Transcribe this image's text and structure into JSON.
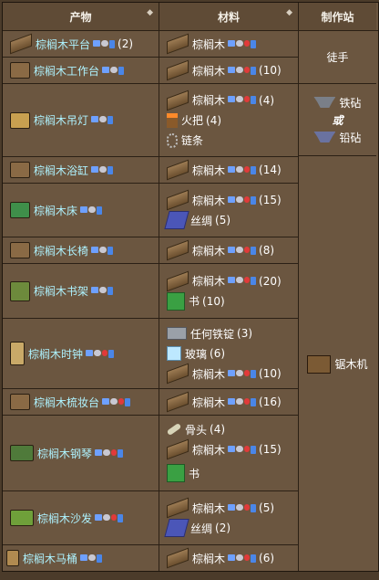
{
  "header": {
    "product": "产物",
    "materials": "材料",
    "station": "制作站"
  },
  "rows": [
    {
      "product": "棕榈木平台",
      "product_count": "(2)",
      "mats": [
        {
          "name": "棕榈木",
          "count": ""
        }
      ],
      "station": "徒手"
    },
    {
      "product": "棕榈木工作台",
      "product_count": "",
      "mats": [
        {
          "name": "棕榈木",
          "count": "(10)"
        }
      ]
    },
    {
      "product": "棕榈木吊灯",
      "product_count": "",
      "mats": [
        {
          "name": "棕榈木",
          "count": "(4)"
        },
        {
          "name": "火把",
          "count": "(4)"
        },
        {
          "name": "链条",
          "count": ""
        }
      ],
      "station_a": "铁砧",
      "station_or": "或",
      "station_b": "铅砧"
    },
    {
      "product": "棕榈木浴缸",
      "product_count": "",
      "mats": [
        {
          "name": "棕榈木",
          "count": "(14)"
        }
      ]
    },
    {
      "product": "棕榈木床",
      "product_count": "",
      "mats": [
        {
          "name": "棕榈木",
          "count": "(15)"
        },
        {
          "name": "丝绸",
          "count": "(5)"
        }
      ]
    },
    {
      "product": "棕榈木长椅",
      "product_count": "",
      "mats": [
        {
          "name": "棕榈木",
          "count": "(8)"
        }
      ]
    },
    {
      "product": "棕榈木书架",
      "product_count": "",
      "mats": [
        {
          "name": "棕榈木",
          "count": "(20)"
        },
        {
          "name": "书",
          "count": "(10)"
        }
      ]
    },
    {
      "product": "棕榈木时钟",
      "product_count": "",
      "mats": [
        {
          "name": "任何铁锭",
          "count": "(3)"
        },
        {
          "name": "玻璃",
          "count": "(6)"
        },
        {
          "name": "棕榈木",
          "count": "(10)"
        }
      ]
    },
    {
      "product": "棕榈木梳妆台",
      "product_count": "",
      "mats": [
        {
          "name": "棕榈木",
          "count": "(16)"
        }
      ]
    },
    {
      "product": "棕榈木钢琴",
      "product_count": "",
      "mats": [
        {
          "name": "骨头",
          "count": "(4)"
        },
        {
          "name": "棕榈木",
          "count": "(15)"
        },
        {
          "name": "书",
          "count": ""
        }
      ]
    },
    {
      "product": "棕榈木沙发",
      "product_count": "",
      "mats": [
        {
          "name": "棕榈木",
          "count": "(5)"
        },
        {
          "name": "丝绸",
          "count": "(2)"
        }
      ]
    },
    {
      "product": "棕榈木马桶",
      "product_count": "",
      "mats": [
        {
          "name": "棕榈木",
          "count": "(6)"
        }
      ]
    }
  ],
  "stations": {
    "bare_hands": "徒手",
    "iron_anvil": "铁砧",
    "or": "或",
    "lead_anvil": "铅砧",
    "sawmill": "锯木机"
  }
}
